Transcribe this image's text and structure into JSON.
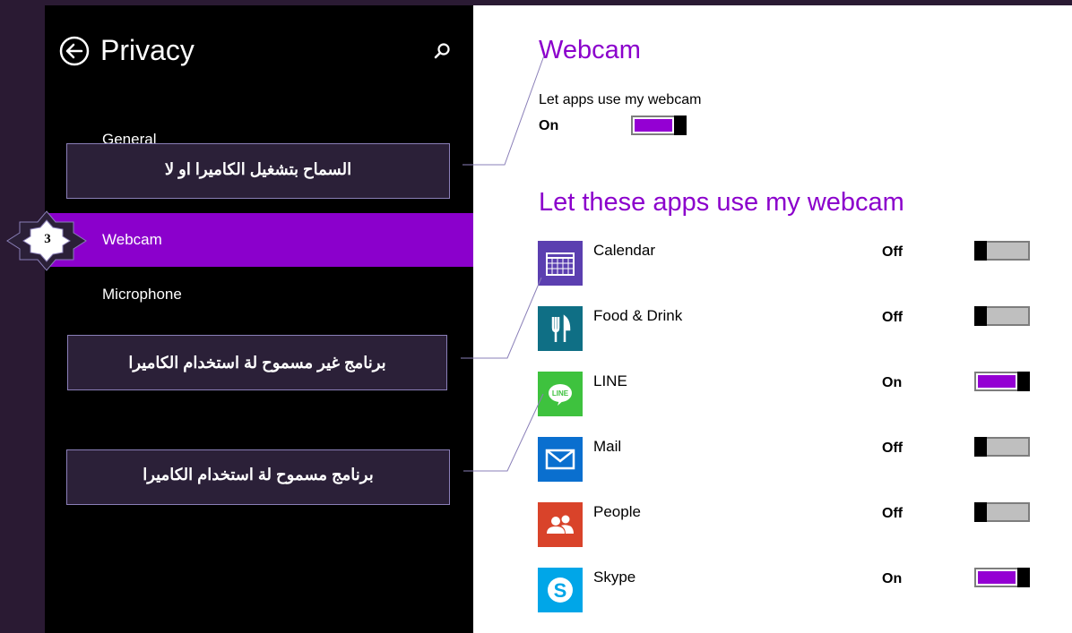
{
  "settings_pane": {
    "title": "Privacy",
    "nav": [
      {
        "label": "General"
      },
      {
        "label": "Webcam",
        "selected": true
      },
      {
        "label": "Microphone"
      }
    ]
  },
  "annotations": {
    "step_number": "3",
    "callouts": [
      "السماح بتشغيل الكاميرا او لا",
      "برنامج غير مسموح لة استخدام الكاميرا",
      "برنامج مسموح لة استخدام الكاميرا"
    ]
  },
  "webcam": {
    "title": "Webcam",
    "master_label": "Let apps use my webcam",
    "master_state": "On",
    "apps_title": "Let these apps use my webcam",
    "apps": [
      {
        "name": "Calendar",
        "state": "Off",
        "icon": "calendar-icon",
        "color": "#5b3fb0"
      },
      {
        "name": "Food & Drink",
        "state": "Off",
        "icon": "food-drink-icon",
        "color": "#0f6f85"
      },
      {
        "name": "LINE",
        "state": "On",
        "icon": "line-icon",
        "color": "#3ec23e"
      },
      {
        "name": "Mail",
        "state": "Off",
        "icon": "mail-icon",
        "color": "#0a6fcf"
      },
      {
        "name": "People",
        "state": "Off",
        "icon": "people-icon",
        "color": "#d9432a"
      },
      {
        "name": "Skype",
        "state": "On",
        "icon": "skype-icon",
        "color": "#00a6e8"
      }
    ]
  },
  "colors": {
    "accent": "#8b00cc",
    "toggle_on": "#9400d3",
    "toggle_off": "#bfbfbf",
    "pane_bg": "#000000",
    "callout_bg": "#2b2038"
  }
}
